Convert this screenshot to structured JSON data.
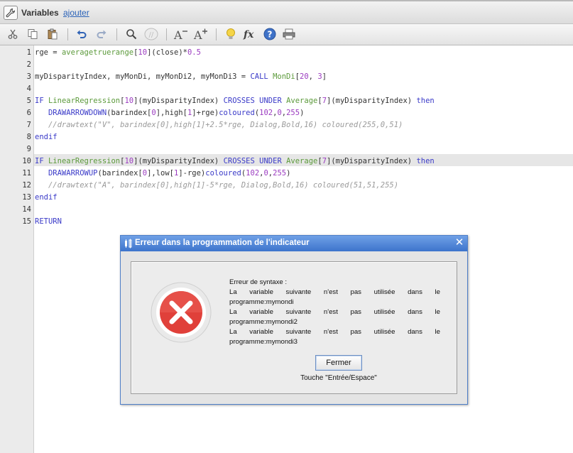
{
  "varbar": {
    "title": "Variables",
    "add_link": "ajouter",
    "icon": "wrench-icon"
  },
  "toolbar": {
    "buttons": [
      "cut-icon",
      "copy-icon",
      "paste-icon",
      "undo-icon",
      "redo-icon",
      "search-icon",
      "comment-icon",
      "font-decrease-icon",
      "font-increase-icon",
      "lightbulb-icon",
      "function-icon",
      "help-icon",
      "print-icon"
    ],
    "font_decrease_glyph": "A",
    "font_increase_glyph": "A",
    "fx_glyph": "fx",
    "help_glyph": "?"
  },
  "editor": {
    "current_line": 10,
    "lines": [
      {
        "n": "1",
        "code": "rge = averagetruerange[10](close)*0.5"
      },
      {
        "n": "2",
        "code": ""
      },
      {
        "n": "3",
        "code": "myDisparityIndex, myMonDi, myMonDi2, myMonDi3 = CALL MonDi[20, 3]"
      },
      {
        "n": "4",
        "code": ""
      },
      {
        "n": "5",
        "code": "IF LinearRegression[10](myDisparityIndex) CROSSES UNDER Average[7](myDisparityIndex) then"
      },
      {
        "n": "6",
        "code": "   DRAWARROWDOWN(barindex[0],high[1]+rge)coloured(102,0,255)"
      },
      {
        "n": "7",
        "code": "   //drawtext(\"V\", barindex[0],high[1]+2.5*rge, Dialog,Bold,16) coloured(255,0,51)"
      },
      {
        "n": "8",
        "code": "endif"
      },
      {
        "n": "9",
        "code": ""
      },
      {
        "n": "10",
        "code": "IF LinearRegression[10](myDisparityIndex) CROSSES UNDER Average[7](myDisparityIndex) then"
      },
      {
        "n": "11",
        "code": "   DRAWARROWUP(barindex[0],low[1]-rge)coloured(102,0,255)"
      },
      {
        "n": "12",
        "code": "   //drawtext(\"A\", barindex[0],high[1]-5*rge, Dialog,Bold,16) coloured(51,51,255)"
      },
      {
        "n": "13",
        "code": "endif"
      },
      {
        "n": "14",
        "code": ""
      },
      {
        "n": "15",
        "code": "RETURN"
      }
    ]
  },
  "dialog": {
    "title": "Erreur dans la programmation de l'indicateur",
    "close_glyph": "✕",
    "message_header": "Erreur de syntaxe :",
    "messages": [
      {
        "line1": "La variable suivante n'est pas utilisée dans le",
        "line2": "programme:mymondi"
      },
      {
        "line1": "La variable suivante n'est pas utilisée dans le",
        "line2": "programme:mymondi2"
      },
      {
        "line1": "La variable suivante n'est pas utilisée dans le",
        "line2": "programme:mymondi3"
      }
    ],
    "button_label": "Fermer",
    "hint": "Touche \"Entrée/Espace\"",
    "error_icon": "error-x-icon"
  },
  "colors": {
    "keyword": "#3a3ac8",
    "function": "#5c9a3b",
    "number": "#9b3bc0",
    "comment": "#9a9a9a",
    "error_red": "#e0403a",
    "dialog_border": "#4f7fc8"
  }
}
